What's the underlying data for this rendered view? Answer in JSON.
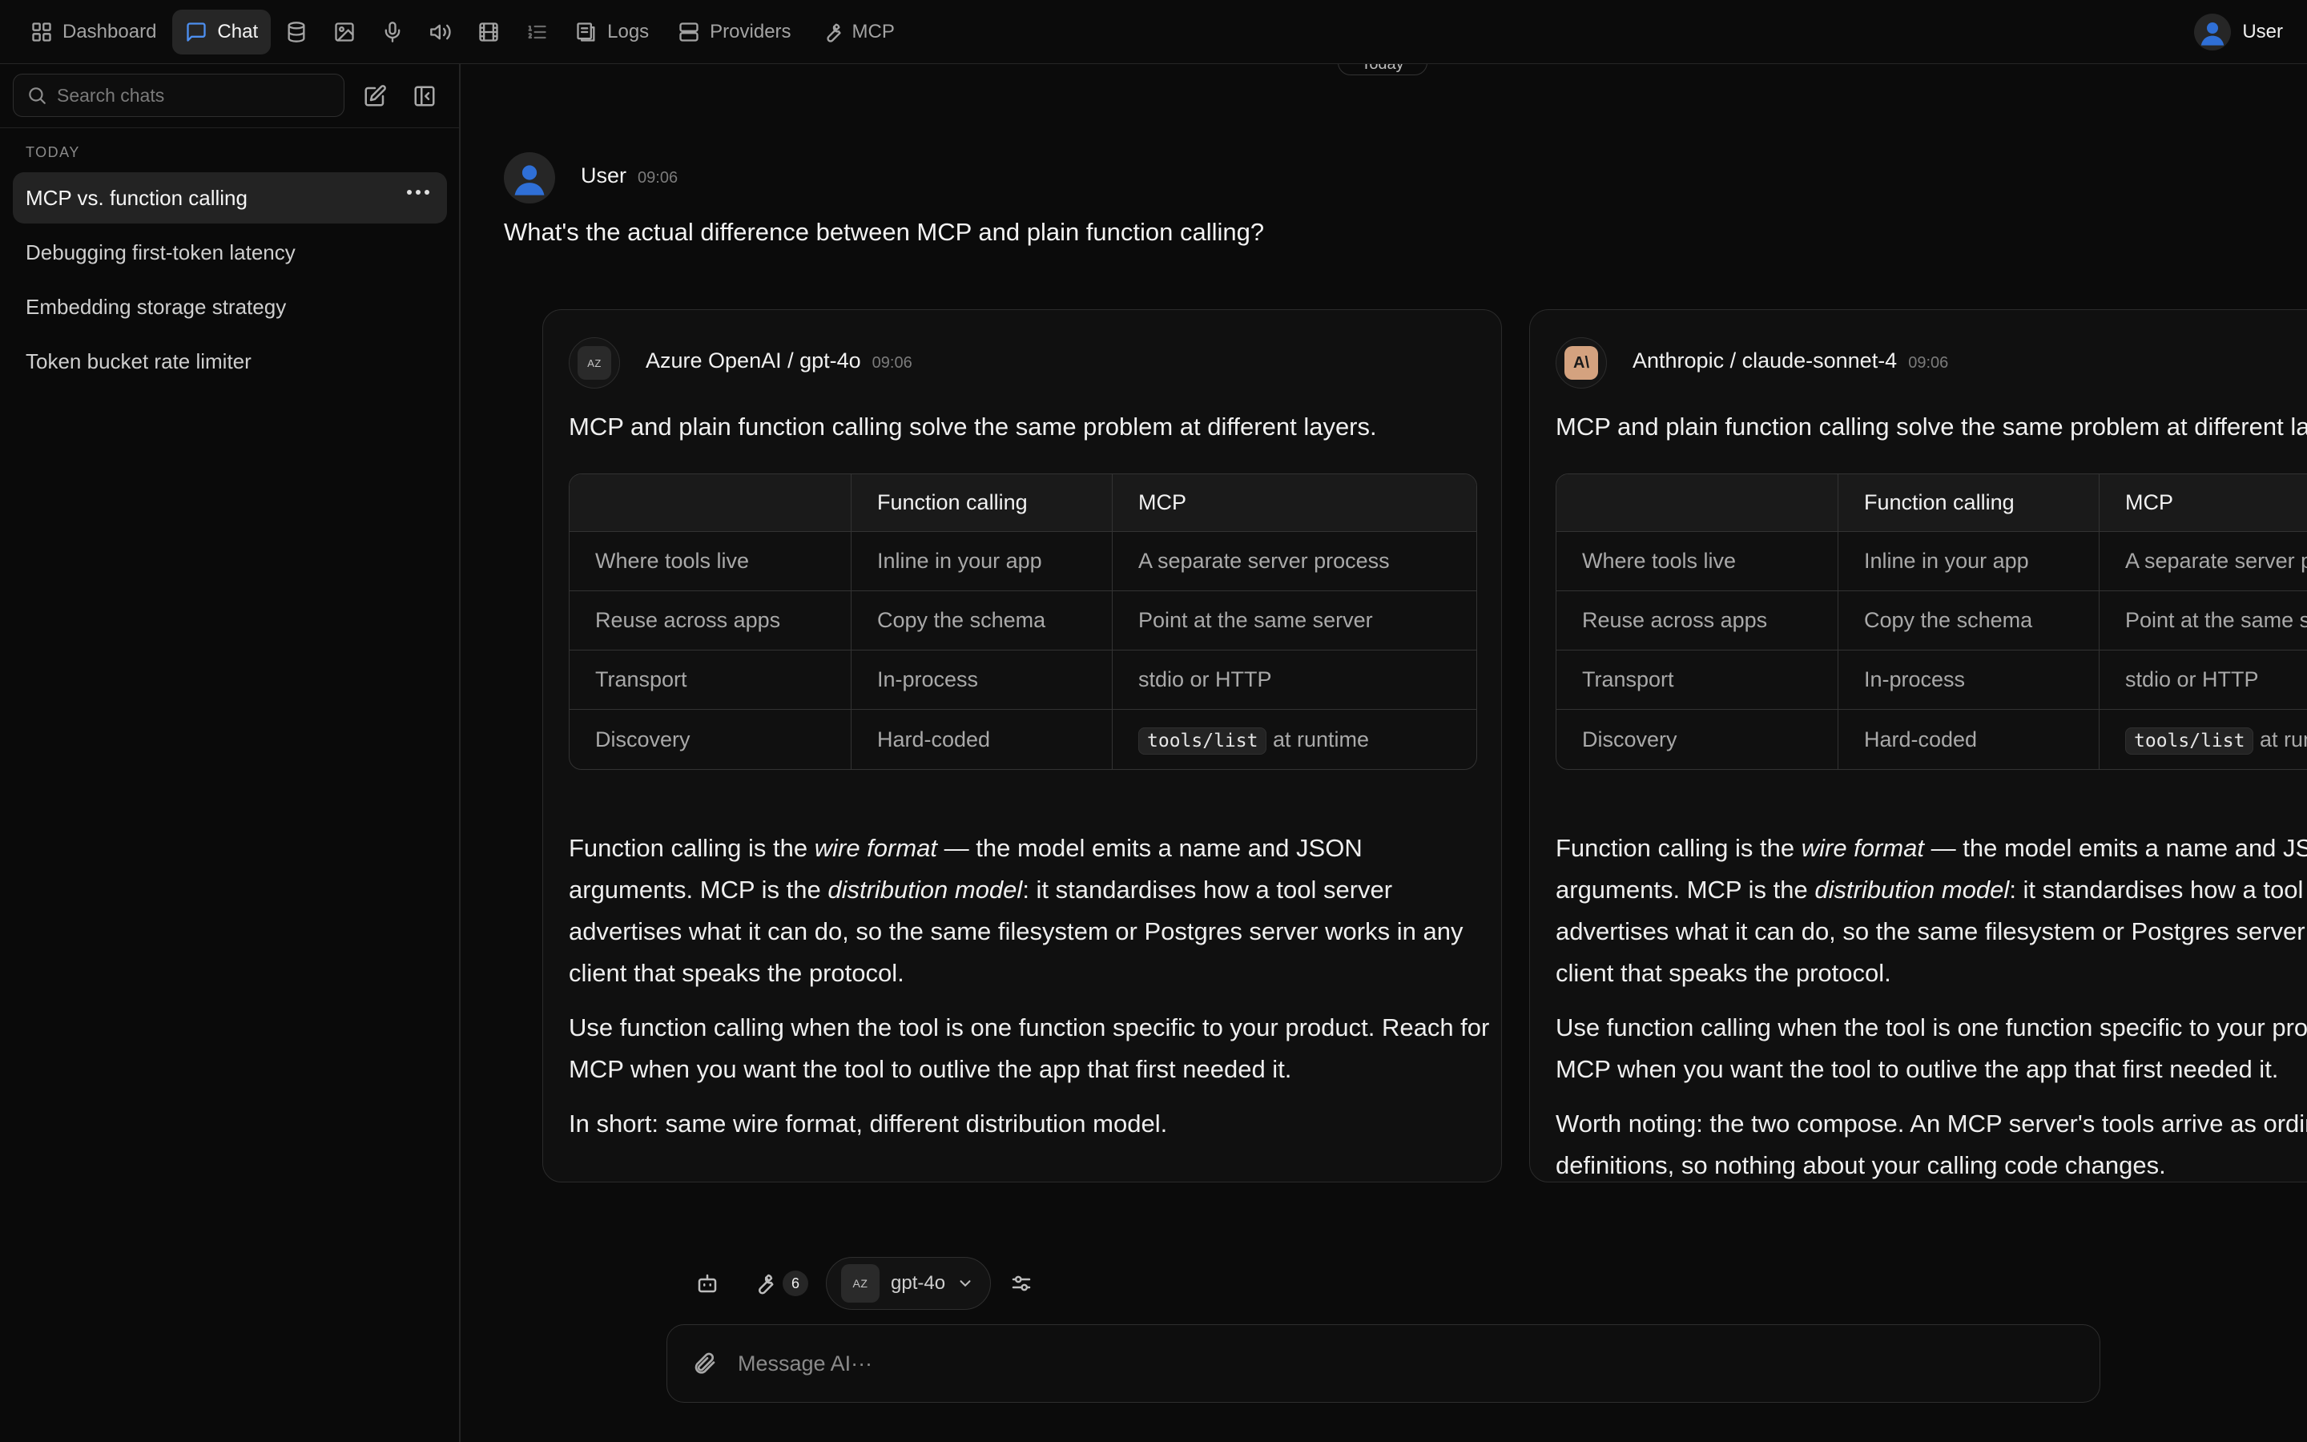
{
  "nav": {
    "dashboard": "Dashboard",
    "chat": "Chat",
    "logs": "Logs",
    "providers": "Providers",
    "mcp": "MCP",
    "user": "User",
    "accent": "#4d8ff0"
  },
  "sidebar": {
    "search_placeholder": "Search chats",
    "section": "TODAY",
    "items": [
      {
        "label": "MCP vs. function calling"
      },
      {
        "label": "Debugging first-token latency"
      },
      {
        "label": "Embedding storage strategy"
      },
      {
        "label": "Token bucket rate limiter"
      }
    ]
  },
  "conversation": {
    "date_divider": "Today",
    "user_message": {
      "author": "User",
      "time": "09:06",
      "text": "What's the actual difference between MCP and plain function calling?"
    },
    "responses": [
      {
        "provider": "Azure OpenAI / gpt-4o",
        "badge": "AZ",
        "time": "09:06",
        "lead": "MCP and plain function calling solve the same problem at different layers.",
        "table": {
          "headers": [
            "",
            "Function calling",
            "MCP"
          ],
          "rows": [
            [
              "Where tools live",
              "Inline in your app",
              "A separate server process"
            ],
            [
              "Reuse across apps",
              "Copy the schema",
              "Point at the same server"
            ],
            [
              "Transport",
              "In-process",
              "stdio or HTTP"
            ],
            [
              "Discovery",
              "Hard-coded",
              "at runtime"
            ]
          ],
          "code_cell": "tools/list"
        },
        "p1_a": "Function calling is the ",
        "p1_em1": "wire format",
        "p1_b": " — the model emits a name and JSON arguments. MCP is the ",
        "p1_em2": "distribution model",
        "p1_c": ": it standardises how a tool server advertises what it can do, so the same filesystem or Postgres server works in any client that speaks the protocol.",
        "p2": "Use function calling when the tool is one function specific to your product. Reach for MCP when you want the tool to outlive the app that first needed it.",
        "p3": "In short: same wire format, different distribution model."
      },
      {
        "provider": "Anthropic / claude-sonnet-4",
        "badge": "A\\",
        "time": "09:06",
        "lead": "MCP and plain function calling solve the same problem at different layers.",
        "table": {
          "headers": [
            "",
            "Function calling",
            "MCP"
          ],
          "rows": [
            [
              "Where tools live",
              "Inline in your app",
              "A separate server process"
            ],
            [
              "Reuse across apps",
              "Copy the schema",
              "Point at the same server"
            ],
            [
              "Transport",
              "In-process",
              "stdio or HTTP"
            ],
            [
              "Discovery",
              "Hard-coded",
              "at runtime"
            ]
          ],
          "code_cell": "tools/list"
        },
        "p1_a": "Function calling is the ",
        "p1_em1": "wire format",
        "p1_b": " — the model emits a name and JSON arguments. MCP is the ",
        "p1_em2": "distribution model",
        "p1_c": ": it standardises how a tool server advertises what it can do, so the same filesystem or Postgres server works in any client that speaks the protocol.",
        "p2": "Use function calling when the tool is one function specific to your product. Reach for MCP when you want the tool to outlive the app that first needed it.",
        "p3": "Worth noting: the two compose. An MCP server's tools arrive as ordinary function definitions, so nothing about your calling code changes."
      }
    ]
  },
  "composer": {
    "tools_count": "6",
    "model_badge": "AZ",
    "model": "gpt-4o",
    "placeholder": "Message AI···"
  }
}
